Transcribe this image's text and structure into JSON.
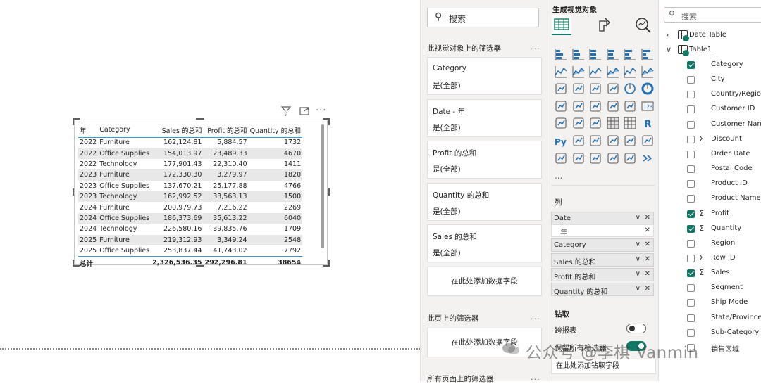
{
  "table": {
    "headers": [
      "年",
      "Category",
      "Sales 的总和",
      "Profit 的总和",
      "Quantity 的总和"
    ],
    "rows": [
      [
        "2022",
        "Furniture",
        "162,124.81",
        "5,884.57",
        "1732"
      ],
      [
        "2022",
        "Office Supplies",
        "154,013.97",
        "23,489.33",
        "4670"
      ],
      [
        "2022",
        "Technology",
        "177,901.43",
        "22,310.40",
        "1411"
      ],
      [
        "2023",
        "Furniture",
        "172,330.30",
        "3,279.97",
        "1820"
      ],
      [
        "2023",
        "Office Supplies",
        "137,670.21",
        "25,177.88",
        "4766"
      ],
      [
        "2023",
        "Technology",
        "162,992.52",
        "33,563.13",
        "1500"
      ],
      [
        "2024",
        "Furniture",
        "200,979.73",
        "7,216.22",
        "2269"
      ],
      [
        "2024",
        "Office Supplies",
        "186,373.69",
        "35,613.22",
        "6040"
      ],
      [
        "2024",
        "Technology",
        "226,580.16",
        "39,835.76",
        "1709"
      ],
      [
        "2025",
        "Furniture",
        "219,312.93",
        "3,349.24",
        "2548"
      ],
      [
        "2025",
        "Office Supplies",
        "253,837.44",
        "41,743.02",
        "7792"
      ]
    ],
    "total": [
      "总计",
      "",
      "2,326,536.35",
      "292,296.81",
      "38654"
    ]
  },
  "visual_header_icons": [
    "filter-icon",
    "focus-mode-icon",
    "more-options-icon"
  ],
  "filters": {
    "search_placeholder": "搜索",
    "section_visual": "此视觉对象上的筛选器",
    "more": "...",
    "cards": [
      {
        "title": "Category",
        "value": "是(全部)"
      },
      {
        "title": "Date - 年",
        "value": "是(全部)"
      },
      {
        "title": "Profit 的总和",
        "value": "是(全部)"
      },
      {
        "title": "Quantity 的总和",
        "value": "是(全部)"
      },
      {
        "title": "Sales 的总和",
        "value": "是(全部)"
      }
    ],
    "add_field": "在此处添加数据字段",
    "section_page": "此页上的筛选器",
    "add_field_page": "在此处添加数据字段",
    "section_all": "所有页面上的筛选器"
  },
  "viz": {
    "title": "生成视觉对象",
    "columns_label": "列",
    "wells": [
      {
        "label": "Date",
        "sub": "年"
      },
      {
        "label": "Category"
      },
      {
        "label": "Sales 的总和"
      },
      {
        "label": "Profit 的总和"
      },
      {
        "label": "Quantity 的总和"
      }
    ],
    "drill_label": "钻取",
    "cross_report_label": "跨报表",
    "cross_report_on": false,
    "keep_filters_label": "保留所有筛选器",
    "keep_filters_on": true,
    "drill_add": "在此处添加钻取字段",
    "more": "...",
    "accent": "#117865"
  },
  "data": {
    "search_placeholder": "搜索",
    "tables": [
      {
        "name": "Date Table",
        "expanded": false
      },
      {
        "name": "Table1",
        "expanded": true
      }
    ],
    "fields": [
      {
        "name": "Category",
        "checked": true,
        "sigma": false
      },
      {
        "name": "City",
        "checked": false,
        "sigma": false
      },
      {
        "name": "Country/Region",
        "checked": false,
        "sigma": false
      },
      {
        "name": "Customer ID",
        "checked": false,
        "sigma": false
      },
      {
        "name": "Customer Name",
        "checked": false,
        "sigma": false
      },
      {
        "name": "Discount",
        "checked": false,
        "sigma": true
      },
      {
        "name": "Order Date",
        "checked": false,
        "sigma": false
      },
      {
        "name": "Postal Code",
        "checked": false,
        "sigma": false
      },
      {
        "name": "Product ID",
        "checked": false,
        "sigma": false
      },
      {
        "name": "Product Name",
        "checked": false,
        "sigma": false
      },
      {
        "name": "Profit",
        "checked": true,
        "sigma": true
      },
      {
        "name": "Quantity",
        "checked": true,
        "sigma": true
      },
      {
        "name": "Region",
        "checked": false,
        "sigma": false
      },
      {
        "name": "Row ID",
        "checked": false,
        "sigma": true
      },
      {
        "name": "Sales",
        "checked": true,
        "sigma": true
      },
      {
        "name": "Segment",
        "checked": false,
        "sigma": false
      },
      {
        "name": "Ship Mode",
        "checked": false,
        "sigma": false
      },
      {
        "name": "State/Province",
        "checked": false,
        "sigma": false
      },
      {
        "name": "Sub-Category",
        "checked": false,
        "sigma": false
      },
      {
        "name": "销售区域",
        "checked": false,
        "sigma": false
      }
    ]
  },
  "watermark": "公众号 @李棋 Vanmin"
}
